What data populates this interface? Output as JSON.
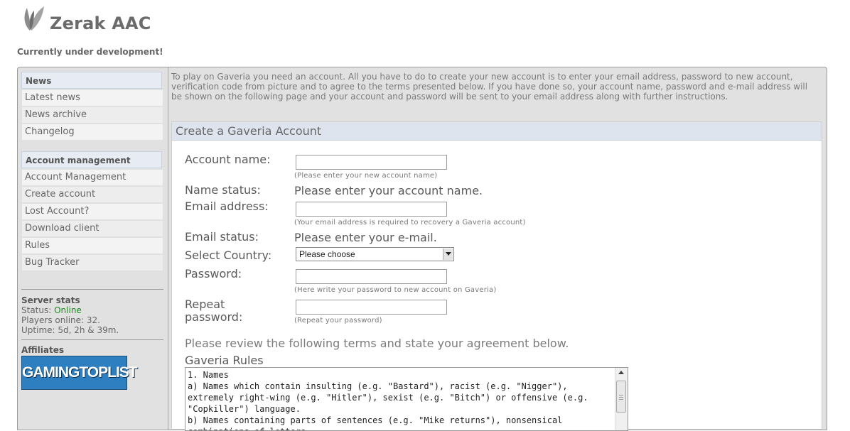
{
  "site": {
    "title": "Zerak AAC",
    "tagline": "Currently under development!",
    "logo_icon": "leaf-icon"
  },
  "sidebar": {
    "news_header": "News",
    "news_items": [
      {
        "label": "Latest news"
      },
      {
        "label": "News archive"
      },
      {
        "label": "Changelog"
      }
    ],
    "account_header": "Account management",
    "account_items": [
      {
        "label": "Account Management"
      },
      {
        "label": "Create account"
      },
      {
        "label": "Lost Account?"
      },
      {
        "label": "Download client"
      },
      {
        "label": "Rules"
      },
      {
        "label": "Bug Tracker"
      }
    ],
    "server_stats": {
      "title": "Server stats",
      "status_label": "Status:",
      "status_value": "Online",
      "players": "Players online: 32.",
      "uptime": "Uptime: 5d, 2h & 39m."
    },
    "affiliates": {
      "title": "Affiliates",
      "banner_text": "GAMINGTOPLIST"
    }
  },
  "main": {
    "intro": "To play on Gaveria you need an account. All you have to do to create your new account is to enter your email address, password to new account, verification code from picture and to agree to the terms presented below. If you have done so, your account name, password and e-mail address will be shown on the following page and your account and password will be sent to your email address along with further instructions.",
    "panel_title": "Create a Gaveria Account",
    "form": {
      "account_name_label": "Account name:",
      "account_name_value": "",
      "account_name_hint": "(Please enter your new account name)",
      "name_status_label": "Name status:",
      "name_status_value": "Please enter your account name.",
      "email_label": "Email address:",
      "email_value": "",
      "email_hint": "(Your email address is required to recovery a Gaveria account)",
      "email_status_label": "Email status:",
      "email_status_value": "Please enter your e-mail.",
      "country_label": "Select Country:",
      "country_selected": "Please choose",
      "password_label": "Password:",
      "password_value": "",
      "password_hint": "(Here write your password to new account on Gaveria)",
      "repeat_label_1": "Repeat",
      "repeat_label_2": "password:",
      "repeat_value": "",
      "repeat_hint": "(Repeat your password)"
    },
    "review_text": "Please review the following terms and state your agreement below.",
    "rules_title": "Gaveria Rules",
    "rules_text": "1. Names\na) Names which contain insulting (e.g. \"Bastard\"), racist (e.g. \"Nigger\"), extremely right-wing (e.g. \"Hitler\"), sexist (e.g. \"Bitch\") or offensive (e.g. \"Copkiller\") language.\nb) Names containing parts of sentences (e.g. \"Mike returns\"), nonsensical combinations of letters"
  },
  "colors": {
    "frame_bg": "#e1e1e1",
    "menu_header_bg": "#e7ecf4",
    "panel_header_bg": "#dde4ee",
    "online_status": "#1c8c1c",
    "affiliate_banner": "#2e7fc0"
  }
}
